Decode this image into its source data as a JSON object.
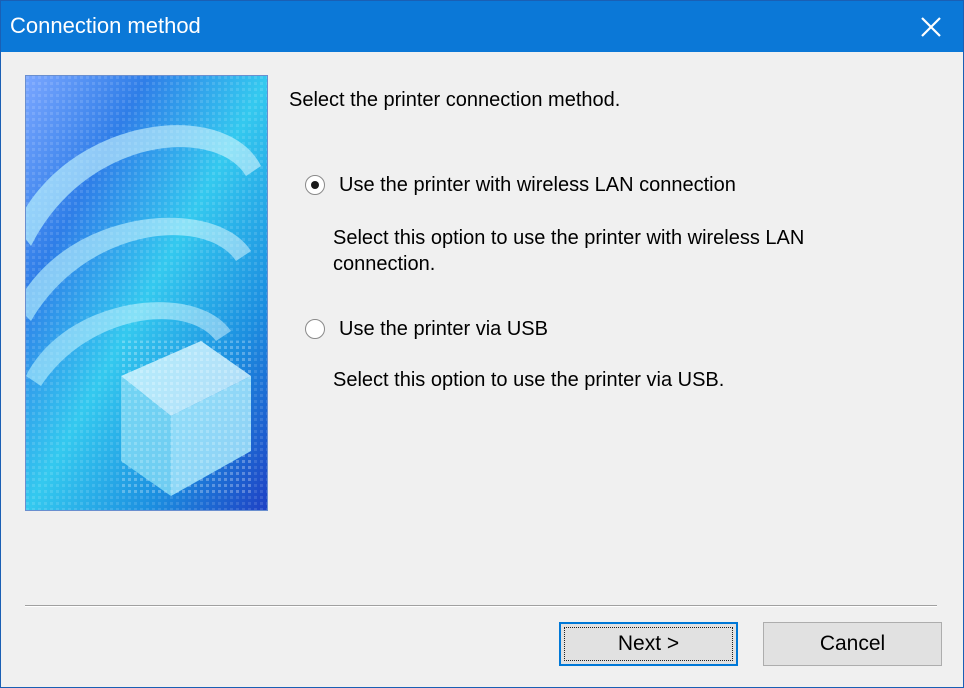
{
  "window": {
    "title": "Connection method",
    "titlebar_color": "#0b78d7",
    "close_icon": "close-icon"
  },
  "main": {
    "prompt": "Select the printer connection method.",
    "options": [
      {
        "label": "Use the printer with wireless LAN connection",
        "description_line1": "Select this option to use the printer with wireless LAN",
        "description_line2": "connection.",
        "selected": true
      },
      {
        "label": "Use the printer via USB",
        "description_line1": "Select this option to use the printer via USB.",
        "selected": false
      }
    ]
  },
  "footer": {
    "next_label": "Next >",
    "cancel_label": "Cancel"
  }
}
